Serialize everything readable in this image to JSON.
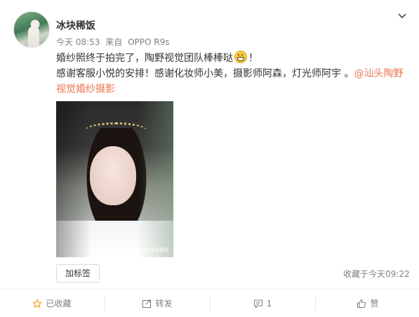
{
  "post": {
    "username": "冰块稀饭",
    "time": "今天 08:53",
    "source_prefix": "来自",
    "source_device": "OPPO R9s",
    "text_line1": "婚纱照终于拍完了，陶野视觉团队棒棒哒",
    "text_line1_after": "！",
    "text_line2_pre": "感谢客服小悦的安排！感谢化妆师小美，摄影师阿森，灯光师阿宇 。",
    "mention": "@汕头陶野",
    "text_line3": "视觉婚纱摄影",
    "emoji_name": "grin-emoji",
    "photo_watermark": "@冰块稀饭"
  },
  "footer": {
    "tag_button": "加标签",
    "favorited_time": "收藏于今天09:22"
  },
  "actions": {
    "favorite": "已收藏",
    "repost": "转发",
    "comment": "1",
    "like": "赞"
  },
  "icons": {
    "more": "chevron-down-icon",
    "favorite": "star-icon",
    "repost": "repost-icon",
    "comment": "comment-icon",
    "like": "thumbs-up-icon"
  },
  "colors": {
    "link": "#eb7350",
    "muted": "#808080"
  }
}
